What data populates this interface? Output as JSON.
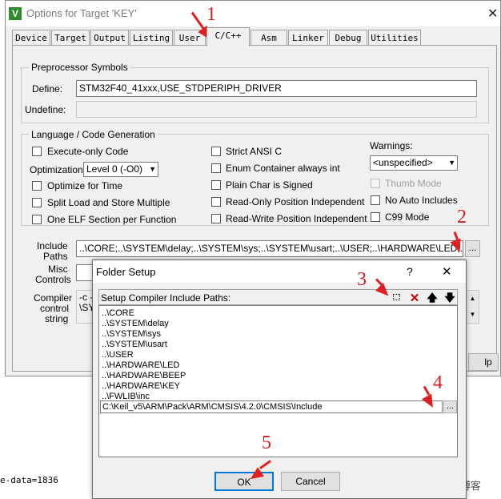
{
  "window": {
    "title": "Options for Target 'KEY'",
    "icon": "keil-v-icon",
    "close_symbol": "✕"
  },
  "tabs": [
    "Device",
    "Target",
    "Output",
    "Listing",
    "User",
    "C/C++",
    "Asm",
    "Linker",
    "Debug",
    "Utilities"
  ],
  "active_tab": "C/C++",
  "preprocessor": {
    "group_label": "Preprocessor Symbols",
    "define_label": "Define:",
    "define_value": "STM32F40_41xxx,USE_STDPERIPH_DRIVER",
    "undefine_label": "Undefine:",
    "undefine_value": ""
  },
  "language": {
    "group_label": "Language / Code Generation",
    "execute_only": "Execute-only Code",
    "optimization_label": "Optimization:",
    "optimization_value": "Level 0 (-O0)",
    "optimize_time": "Optimize for Time",
    "split_load_store": "Split Load and Store Multiple",
    "one_elf_section": "One ELF Section per Function",
    "strict_ansi": "Strict ANSI C",
    "enum_container": "Enum Container always int",
    "plain_char_signed": "Plain Char is Signed",
    "readonly_pi": "Read-Only Position Independent",
    "readwrite_pi": "Read-Write Position Independent",
    "warnings_label": "Warnings:",
    "warnings_value": "<unspecified>",
    "thumb_mode": "Thumb Mode",
    "no_auto_includes": "No Auto Includes",
    "c99_mode": "C99 Mode"
  },
  "include": {
    "label_line1": "Include",
    "label_line2": "Paths",
    "value": "..\\CORE;..\\SYSTEM\\delay;..\\SYSTEM\\sys;..\\SYSTEM\\usart;..\\USER;..\\HARDWARE\\LED;..\\HAR",
    "browse": "..."
  },
  "misc": {
    "label_line1": "Misc",
    "label_line2": "Controls"
  },
  "compiler": {
    "label_line1": "Compiler",
    "label_line2": "control",
    "label_line3": "string",
    "text_line1": "-c --",
    "text_line2": "\\SY"
  },
  "help_button_fragment": "lp",
  "folder_setup": {
    "title": "Folder Setup",
    "help_symbol": "?",
    "close_symbol": "✕",
    "header_label": "Setup Compiler Include Paths:",
    "paths": [
      "..\\CORE",
      "..\\SYSTEM\\delay",
      "..\\SYSTEM\\sys",
      "..\\SYSTEM\\usart",
      "..\\USER",
      "..\\HARDWARE\\LED",
      "..\\HARDWARE\\BEEP",
      "..\\HARDWARE\\KEY",
      "..\\FWLIB\\inc"
    ],
    "edit_value": "C:\\Keil_v5\\ARM\\Pack\\ARM\\CMSIS\\4.2.0\\CMSIS\\Include",
    "edit_browse": "...",
    "ok_label": "OK",
    "cancel_label": "Cancel"
  },
  "background_text": "e-data=1836",
  "annotations": [
    "1",
    "2",
    "3",
    "4",
    "5"
  ],
  "watermark": "@51CTO博客",
  "colors": {
    "annotation_red": "#e02020",
    "window_bg": "#f0f0f0"
  }
}
